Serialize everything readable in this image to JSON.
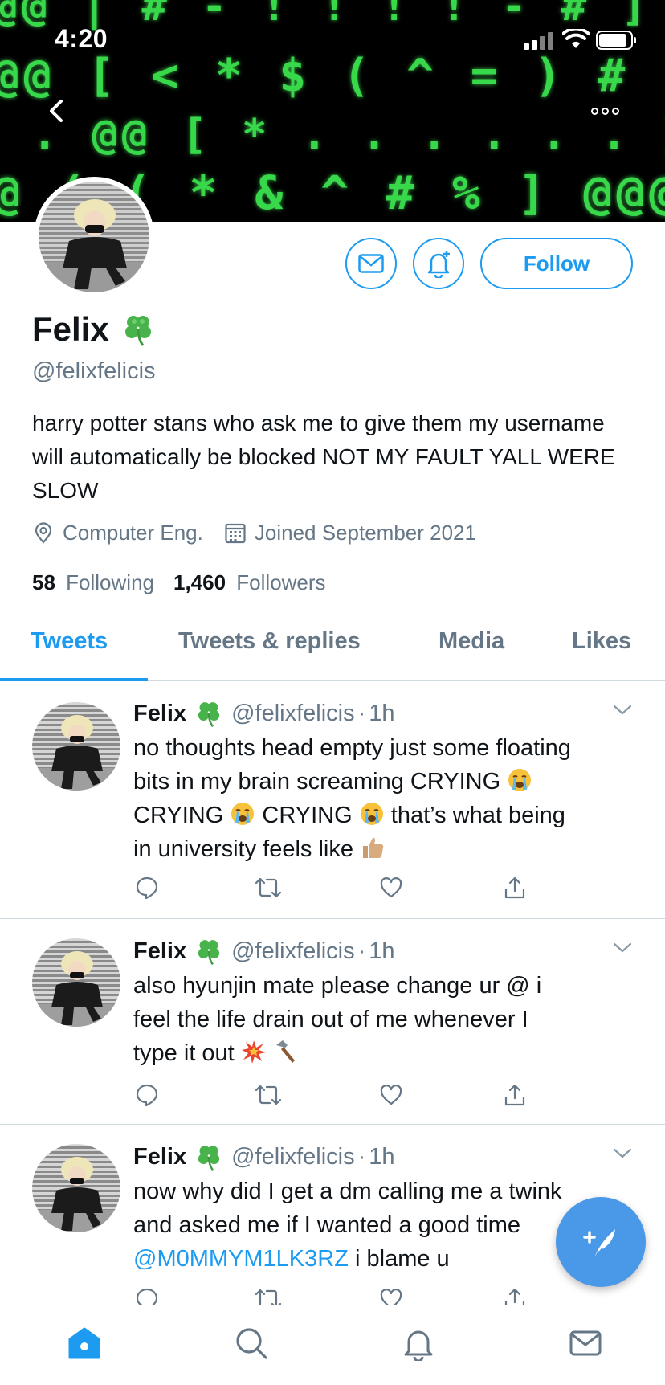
{
  "status_bar": {
    "time": "4:20"
  },
  "banner": {
    "rows": [
      "@@ | # - ! ! ! ! - # ] @@@@ =",
      "@@ [ < * $ ( ^ = ) # ] @@@@ [ $",
      ". @@ [ * . . . . . . ] @@ . .",
      "@ ( ( * & ^ # % ] @@@@ [ < *"
    ]
  },
  "profile": {
    "name": "Felix",
    "handle": "@felixfelicis",
    "bio": "harry potter stans who ask me to give them my username will automatically be blocked NOT MY FAULT YALL WERE SLOW",
    "location": "Computer Eng.",
    "joined": "Joined September 2021",
    "following_count": "58",
    "following_label": "Following",
    "followers_count": "1,460",
    "followers_label": "Followers",
    "follow_button": "Follow"
  },
  "tabs": [
    {
      "label": "Tweets",
      "active": true
    },
    {
      "label": "Tweets & replies",
      "active": false
    },
    {
      "label": "Media",
      "active": false
    },
    {
      "label": "Likes",
      "active": false
    }
  ],
  "tweets": [
    {
      "name": "Felix",
      "handle": "@felixfelicis",
      "sep": "·",
      "time": "1h",
      "line1": "no thoughts head empty just some floating",
      "line2a": "bits in my brain screaming CRYING",
      "line3a": "CRYING",
      "line3b": "CRYING",
      "line3c": "that’s what being",
      "line4a": "in university feels like"
    },
    {
      "name": "Felix",
      "handle": "@felixfelicis",
      "sep": "·",
      "time": "1h",
      "line1": "also hyunjin mate please change ur @ i",
      "line2": "feel the life drain out of me whenever I",
      "line3a": "type it out"
    },
    {
      "name": "Felix",
      "handle": "@felixfelicis",
      "sep": "·",
      "time": "1h",
      "line1": "now why did I get a dm calling me a twink",
      "line2": "and asked me if I wanted a good time",
      "mention": "@M0MMYM1LK3RZ",
      "line3b": "i blame u"
    }
  ],
  "colors": {
    "accent": "#1d9bf0",
    "muted": "#657786",
    "fab": "#4a99e9"
  },
  "icons": {
    "back": "chevron-left-icon",
    "more": "more-options-icon",
    "message": "mail-icon",
    "notify": "bell-plus-icon",
    "location": "location-pin-icon",
    "calendar": "calendar-icon",
    "reply": "reply-icon",
    "retweet": "retweet-icon",
    "like": "heart-icon",
    "share": "share-icon",
    "compose": "compose-feather-icon",
    "home": "home-icon",
    "search": "search-icon",
    "notifications": "bell-icon",
    "messages": "mail-icon"
  }
}
